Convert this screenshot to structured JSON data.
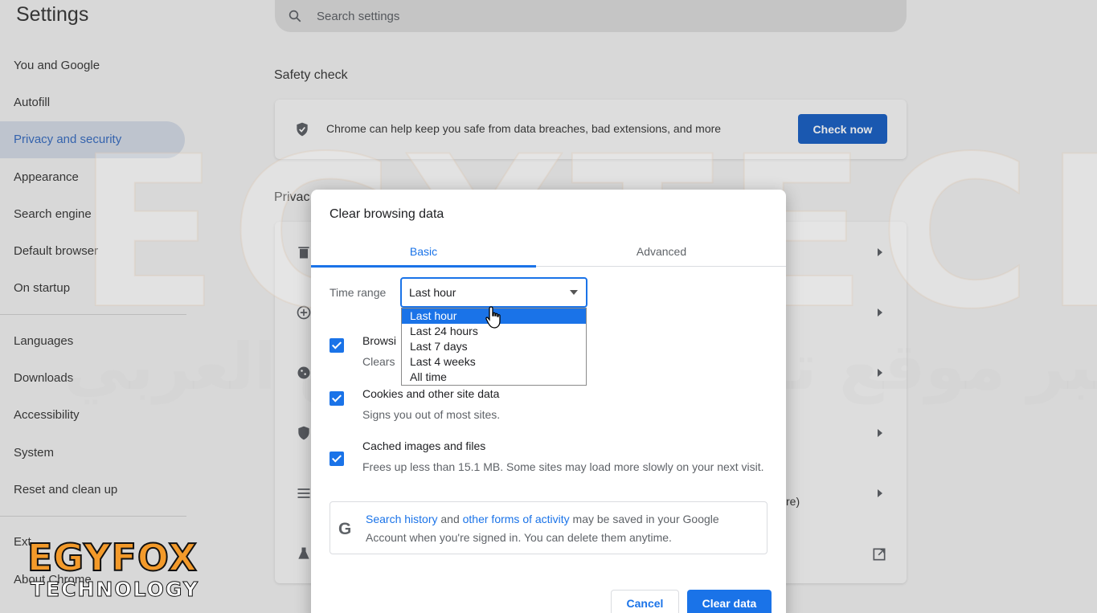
{
  "app_title": "Settings",
  "search": {
    "placeholder": "Search settings"
  },
  "sidebar": {
    "group1": [
      {
        "label": "You and Google",
        "active": false
      },
      {
        "label": "Autofill",
        "active": false
      },
      {
        "label": "Privacy and security",
        "active": true
      },
      {
        "label": "Appearance",
        "active": false
      },
      {
        "label": "Search engine",
        "active": false
      },
      {
        "label": "Default browser",
        "active": false
      },
      {
        "label": "On startup",
        "active": false
      }
    ],
    "group2": [
      {
        "label": "Languages"
      },
      {
        "label": "Downloads"
      },
      {
        "label": "Accessibility"
      },
      {
        "label": "System"
      },
      {
        "label": "Reset and clean up"
      }
    ],
    "extensions_partial": "Ext",
    "about_partial": "About Chrome"
  },
  "safety_check": {
    "title": "Safety check",
    "text": "Chrome can help keep you safe from data breaches, bad extensions, and more",
    "button": "Check now"
  },
  "privacy_section": {
    "title_partial": "Privac",
    "row_partial": "re)"
  },
  "dialog": {
    "title": "Clear browsing data",
    "tabs": [
      {
        "label": "Basic",
        "active": true
      },
      {
        "label": "Advanced",
        "active": false
      }
    ],
    "time_range": {
      "label": "Time range",
      "value": "Last hour",
      "options": [
        "Last hour",
        "Last 24 hours",
        "Last 7 days",
        "Last 4 weeks",
        "All time"
      ]
    },
    "items": [
      {
        "title": "Browsi",
        "desc": "Clears",
        "checked": true
      },
      {
        "title": "Cookies and other site data",
        "desc": "Signs you out of most sites.",
        "checked": true
      },
      {
        "title": "Cached images and files",
        "desc": "Frees up less than 15.1 MB. Some sites may load more slowly on your next visit.",
        "checked": true
      }
    ],
    "info": {
      "link1": "Search history",
      "and": " and ",
      "link2": "other forms of activity",
      "rest": " may be saved in your Google Account when you're signed in. You can delete them anytime."
    },
    "cancel": "Cancel",
    "clear": "Clear data"
  },
  "watermark": {
    "text": "EGYTECH",
    "arabic": "أكبر موقع تقني في الوطن العربي"
  },
  "logo": {
    "main": "EGYFOX",
    "sub": "TECHNOLOGY"
  },
  "colors": {
    "accent": "#1a73e8",
    "sidebar_active": "#3b6fc1",
    "logo_orange": "#f39a2a"
  }
}
